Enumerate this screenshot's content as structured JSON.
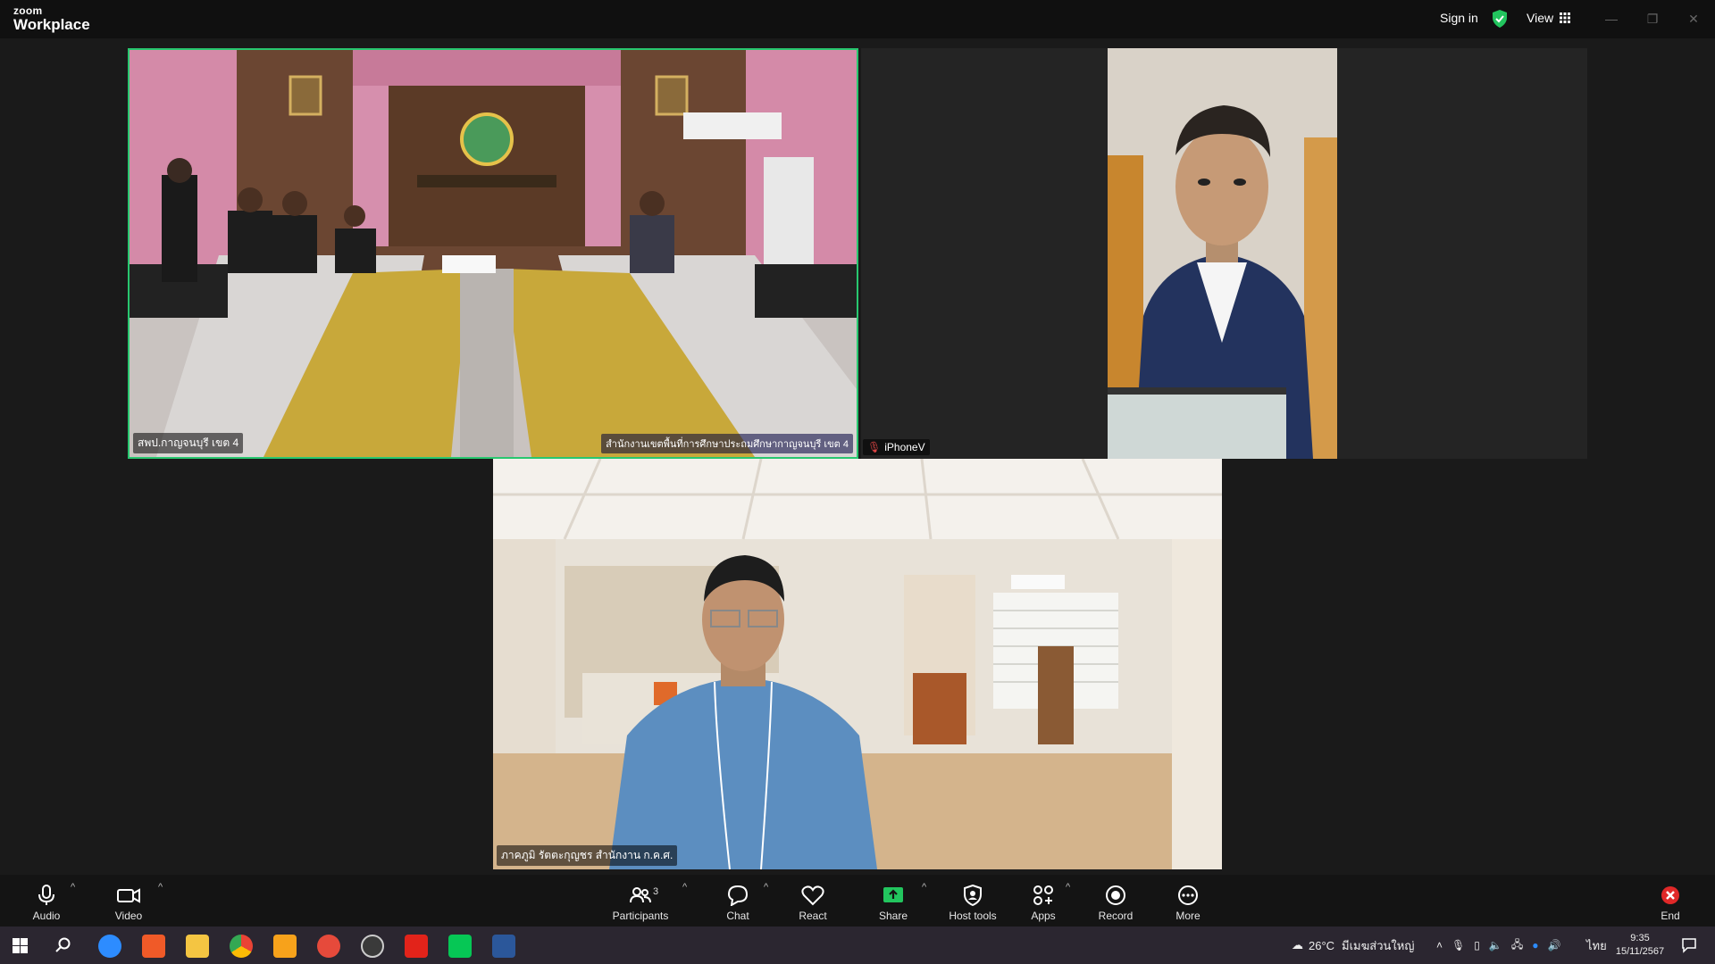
{
  "app": {
    "logo_small": "zoom",
    "logo_big": "Workplace",
    "sign_in": "Sign in",
    "view": "View"
  },
  "colors": {
    "active_speaker_border": "#28c76f",
    "end_button": "#e02828",
    "share_green": "#22c55e"
  },
  "participants": [
    {
      "name": "สพป.กาญจนบุรี เขต 4",
      "watermark": "สำนักงานเขตพื้นที่การศึกษาประถมศึกษากาญจนบุรี เขต 4",
      "active_speaker": true
    },
    {
      "name": "iPhoneV",
      "muted": true
    },
    {
      "name": "ภาคภูมิ รัตตะกุญชร สำนักงาน ก.ค.ศ."
    }
  ],
  "toolbar": {
    "audio": "Audio",
    "video": "Video",
    "participants": "Participants",
    "participants_count": "3",
    "chat": "Chat",
    "react": "React",
    "share": "Share",
    "host_tools": "Host tools",
    "apps": "Apps",
    "record": "Record",
    "more": "More",
    "end": "End"
  },
  "taskbar": {
    "weather": "26°C",
    "weather_text": "มีเมฆส่วนใหญ่",
    "language": "ไทย",
    "time": "9:35",
    "date": "15/11/2567",
    "apps": [
      "start-icon",
      "search-icon",
      "zoom-icon",
      "slides-icon",
      "file-explorer-icon",
      "chrome-icon",
      "app-icon",
      "screen-recorder-icon",
      "obs-icon",
      "acrobat-icon",
      "line-icon",
      "word-icon"
    ]
  }
}
